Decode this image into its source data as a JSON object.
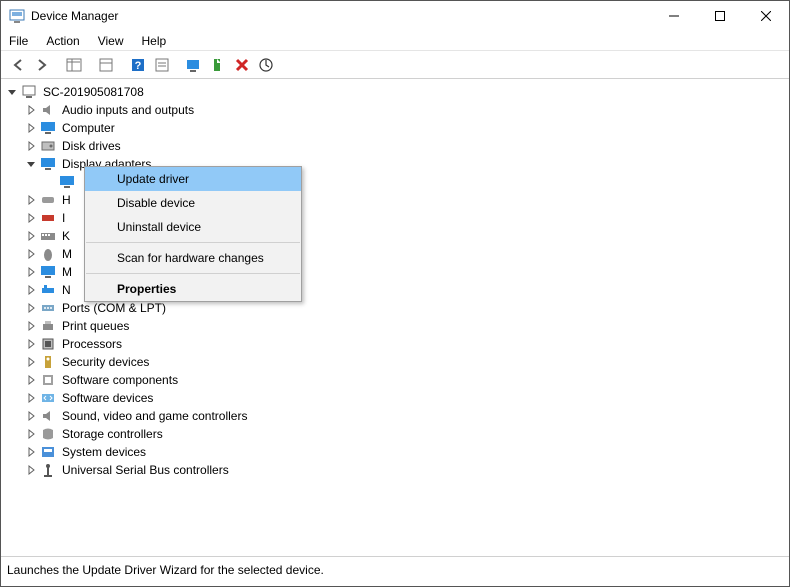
{
  "window": {
    "title": "Device Manager"
  },
  "menubar": [
    "File",
    "Action",
    "View",
    "Help"
  ],
  "root": "SC-201905081708",
  "categories": [
    {
      "name": "Audio inputs and outputs",
      "icon": "speaker",
      "exp": "closed"
    },
    {
      "name": "Computer",
      "icon": "monitor-blue",
      "exp": "closed"
    },
    {
      "name": "Disk drives",
      "icon": "disk",
      "exp": "closed"
    },
    {
      "name": "Display adapters",
      "icon": "monitor-blue",
      "exp": "open"
    },
    {
      "name": "H",
      "icon": "hid",
      "exp": "closed",
      "truncated": true
    },
    {
      "name": "I",
      "icon": "ide-red",
      "exp": "closed",
      "truncated": true
    },
    {
      "name": "K",
      "icon": "keyboard",
      "exp": "closed",
      "truncated": true
    },
    {
      "name": "M",
      "icon": "mouse",
      "exp": "closed",
      "truncated": true
    },
    {
      "name": "M",
      "icon": "monitor-blue",
      "exp": "closed",
      "truncated": true
    },
    {
      "name": "N",
      "icon": "network",
      "exp": "closed",
      "truncated": true
    },
    {
      "name": "Ports (COM & LPT)",
      "icon": "port",
      "exp": "closed"
    },
    {
      "name": "Print queues",
      "icon": "printer",
      "exp": "closed"
    },
    {
      "name": "Processors",
      "icon": "cpu",
      "exp": "closed"
    },
    {
      "name": "Security devices",
      "icon": "security",
      "exp": "closed"
    },
    {
      "name": "Software components",
      "icon": "swcomp",
      "exp": "closed"
    },
    {
      "name": "Software devices",
      "icon": "swdev",
      "exp": "closed"
    },
    {
      "name": "Sound, video and game controllers",
      "icon": "speaker",
      "exp": "closed"
    },
    {
      "name": "Storage controllers",
      "icon": "storage",
      "exp": "closed"
    },
    {
      "name": "System devices",
      "icon": "system",
      "exp": "closed"
    },
    {
      "name": "Universal Serial Bus controllers",
      "icon": "usb",
      "exp": "closed"
    }
  ],
  "context_menu": {
    "items": [
      {
        "label": "Update driver",
        "highlighted": true
      },
      {
        "label": "Disable device"
      },
      {
        "label": "Uninstall device"
      },
      {
        "separator": true
      },
      {
        "label": "Scan for hardware changes"
      },
      {
        "separator": true
      },
      {
        "label": "Properties",
        "bold": true
      }
    ]
  },
  "statusbar": "Launches the Update Driver Wizard for the selected device."
}
